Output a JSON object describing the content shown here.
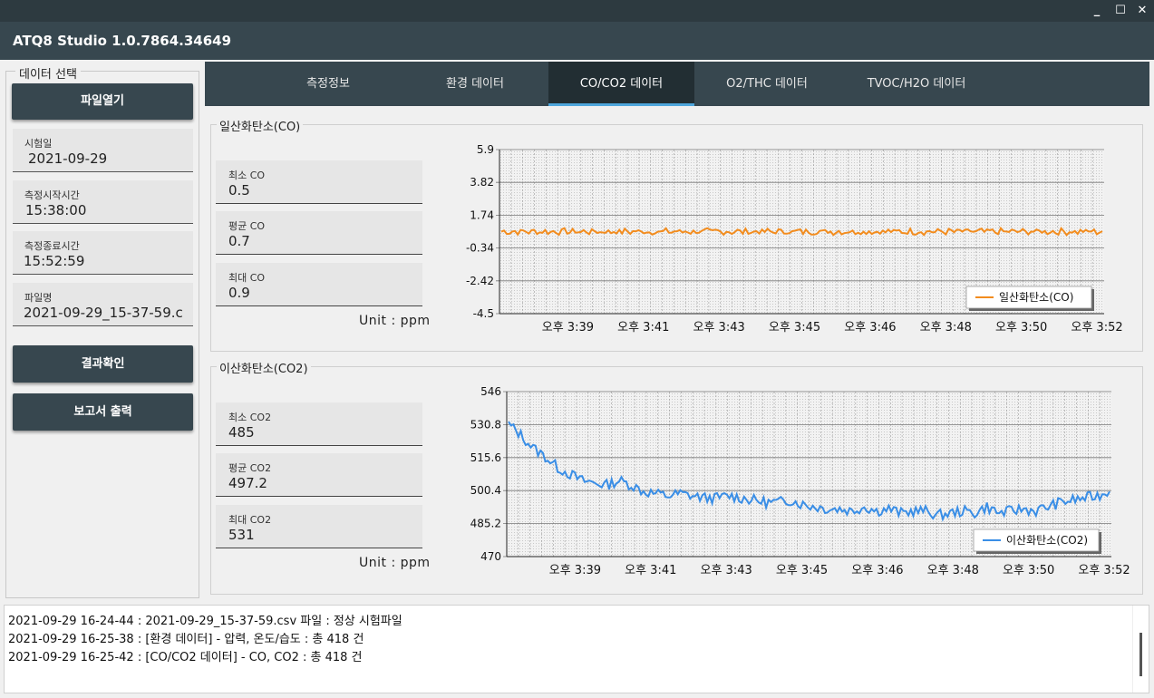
{
  "window": {
    "minimize": "_",
    "maximize": "☐",
    "close": "✕",
    "title": "ATQ8 Studio 1.0.7864.34649"
  },
  "sidebar": {
    "group_title": "데이터 선택",
    "open_button": "파일열기",
    "fields": [
      {
        "label": "시험일",
        "value": "2021-09-29"
      },
      {
        "label": "측정시작시간",
        "value": "15:38:00"
      },
      {
        "label": "측정종료시간",
        "value": "15:52:59"
      },
      {
        "label": "파일명",
        "value": "2021-09-29_15-37-59.c"
      }
    ],
    "result_button": "결과확인",
    "report_button": "보고서 출력"
  },
  "tabs": [
    {
      "label": "측정정보",
      "active": false
    },
    {
      "label": "환경 데이터",
      "active": false
    },
    {
      "label": "CO/CO2 데이터",
      "active": true
    },
    {
      "label": "O2/THC 데이터",
      "active": false
    },
    {
      "label": "TVOC/H2O 데이터",
      "active": false
    }
  ],
  "co_section": {
    "title": "일산화탄소(CO)",
    "stats": [
      {
        "label": "최소 CO",
        "value": "0.5"
      },
      {
        "label": "평균 CO",
        "value": "0.7"
      },
      {
        "label": "최대 CO",
        "value": "0.9"
      }
    ],
    "unit": "Unit : ppm"
  },
  "co2_section": {
    "title": "이산화탄소(CO2)",
    "stats": [
      {
        "label": "최소 CO2",
        "value": "485"
      },
      {
        "label": "평균 CO2",
        "value": "497.2"
      },
      {
        "label": "최대 CO2",
        "value": "531"
      }
    ],
    "unit": "Unit : ppm"
  },
  "chart_data": [
    {
      "type": "line",
      "title": "",
      "ylabel": "",
      "xlabel": "",
      "yticks": [
        "5.9",
        "3.82",
        "1.74",
        "-0.34",
        "-2.42",
        "-4.5"
      ],
      "ylim": [
        -4.5,
        5.9
      ],
      "xticks": [
        "오후 3:39",
        "오후 3:41",
        "오후 3:43",
        "오후 3:45",
        "오후 3:46",
        "오후 3:48",
        "오후 3:50",
        "오후 3:52"
      ],
      "grid": true,
      "legend_position": "bottom-right",
      "series": [
        {
          "name": "일산화탄소(CO)",
          "color": "#f28c1e",
          "values_summary": "fluctuates between about 0.5 and 0.9 throughout 15:38–15:52",
          "min": 0.5,
          "mean": 0.7,
          "max": 0.9
        }
      ]
    },
    {
      "type": "line",
      "title": "",
      "ylabel": "",
      "xlabel": "",
      "yticks": [
        "546",
        "530.8",
        "515.6",
        "500.4",
        "485.2",
        "470"
      ],
      "ylim": [
        470,
        546
      ],
      "xticks": [
        "오후 3:39",
        "오후 3:41",
        "오후 3:43",
        "오후 3:45",
        "오후 3:46",
        "오후 3:48",
        "오후 3:50",
        "오후 3:52"
      ],
      "grid": true,
      "legend_position": "bottom-right",
      "series": [
        {
          "name": "이산화탄소(CO2)",
          "color": "#3a8ee6",
          "values": [
            531,
            526,
            520,
            516,
            511,
            508,
            505,
            504,
            503,
            505,
            503,
            500,
            499,
            498,
            499,
            498,
            497,
            497,
            498,
            497,
            496,
            495,
            495,
            496,
            494,
            493,
            492,
            492,
            491,
            493,
            491,
            492,
            490,
            491,
            491,
            489,
            490,
            491,
            490,
            493,
            490,
            491,
            492,
            491,
            493,
            495,
            496,
            497,
            498,
            500
          ]
        }
      ]
    }
  ],
  "log": [
    "2021-09-29 16-24-44 : 2021-09-29_15-37-59.csv 파일 : 정상 시험파일",
    "2021-09-29 16-25-38 : [환경 데이터] - 압력, 온도/습도 : 총 418 건",
    "2021-09-29 16-25-42 : [CO/CO2 데이터] - CO, CO2 : 총 418 건"
  ]
}
